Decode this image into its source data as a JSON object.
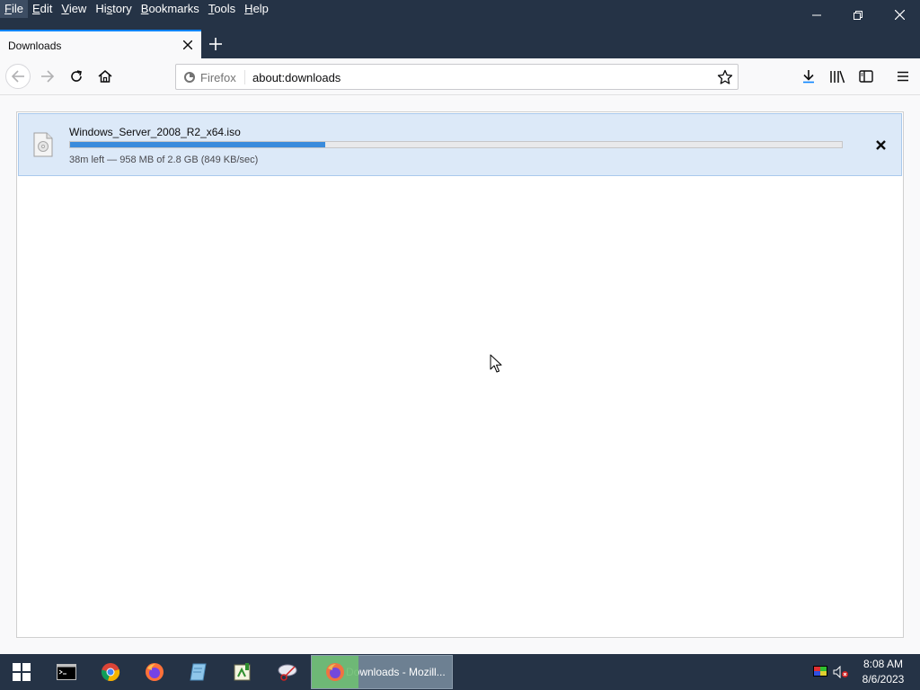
{
  "menu": {
    "items": [
      {
        "label": "File",
        "access": "F",
        "rest": "ile"
      },
      {
        "label": "Edit",
        "access": "E",
        "rest": "dit"
      },
      {
        "label": "View",
        "access": "V",
        "rest": "iew"
      },
      {
        "label": "History",
        "access": "s",
        "pre": "Hi",
        "rest": "tory"
      },
      {
        "label": "Bookmarks",
        "access": "B",
        "rest": "ookmarks"
      },
      {
        "label": "Tools",
        "access": "T",
        "rest": "ools"
      },
      {
        "label": "Help",
        "access": "H",
        "rest": "elp"
      }
    ]
  },
  "tab": {
    "title": "Downloads"
  },
  "urlbar": {
    "identity_label": "Firefox",
    "url": "about:downloads"
  },
  "download": {
    "file_name": "Windows_Server_2008_R2_x64.iso",
    "progress_fraction": 0.331,
    "status": "38m left — 958 MB of 2.8 GB (849 KB/sec)"
  },
  "taskbar": {
    "active_window_label": "Downloads - Mozill...",
    "time": "8:08 AM",
    "date": "8/6/2023"
  },
  "colors": {
    "chrome": "#253346",
    "accent": "#0a84ff",
    "progress": "#3a8bdc",
    "download_row": "#dce9f8"
  }
}
